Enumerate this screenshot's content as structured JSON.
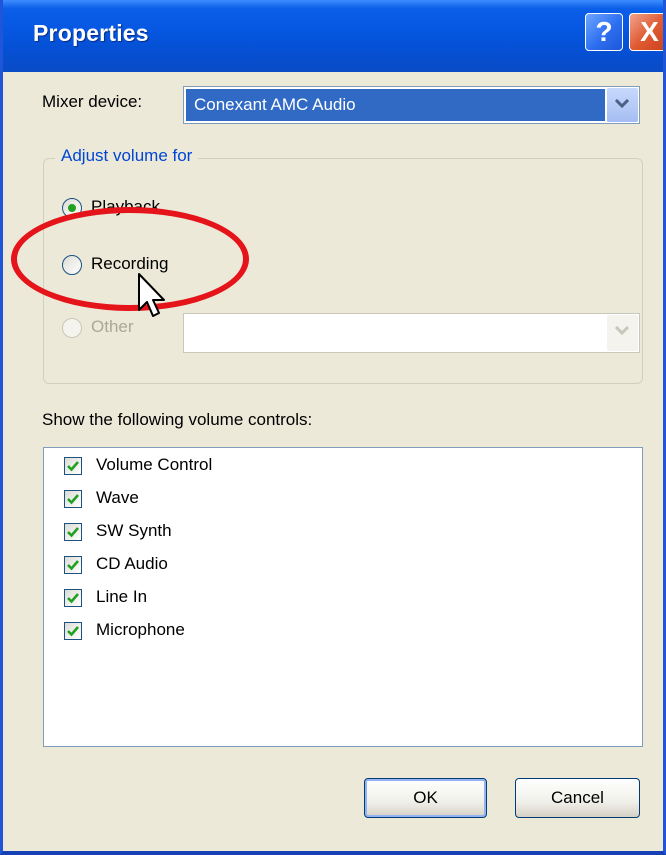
{
  "window": {
    "title": "Properties",
    "help_button": "?",
    "close_button": "X"
  },
  "mixer": {
    "label": "Mixer device:",
    "selected": "Conexant AMC Audio"
  },
  "adjust_group": {
    "legend": "Adjust volume for",
    "options": [
      {
        "label": "Playback",
        "selected": true,
        "enabled": true
      },
      {
        "label": "Recording",
        "selected": false,
        "enabled": true
      },
      {
        "label": "Other",
        "selected": false,
        "enabled": false
      }
    ],
    "other_combo_value": ""
  },
  "controls": {
    "label": "Show the following volume controls:",
    "items": [
      {
        "label": "Volume Control",
        "checked": true
      },
      {
        "label": "Wave",
        "checked": true
      },
      {
        "label": "SW Synth",
        "checked": true
      },
      {
        "label": "CD Audio",
        "checked": true
      },
      {
        "label": "Line In",
        "checked": true
      },
      {
        "label": "Microphone",
        "checked": true
      }
    ]
  },
  "buttons": {
    "ok": "OK",
    "cancel": "Cancel"
  },
  "annotation": {
    "color": "#e4141a",
    "target": "Recording"
  },
  "colors": {
    "titlebar": "#0656e0",
    "selection": "#316ac5",
    "dialog_bg": "#ece9d8",
    "group_legend": "#0046d5",
    "check_mark": "#21a121"
  }
}
